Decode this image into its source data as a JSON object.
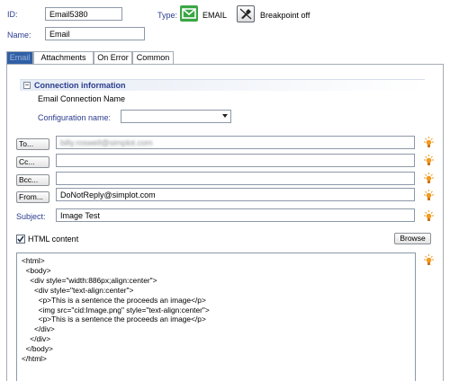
{
  "header": {
    "id_label": "ID:",
    "id_value": "Email5380",
    "name_label": "Name:",
    "name_value": "Email",
    "type_label": "Type:",
    "type_value": "EMAIL",
    "breakpoint_label": "Breakpoint off"
  },
  "tabs": [
    {
      "label": "Email",
      "active": true
    },
    {
      "label": "Attachments",
      "active": false
    },
    {
      "label": "On Error",
      "active": false
    },
    {
      "label": "Common",
      "active": false
    }
  ],
  "connection": {
    "section_title": "Connection information",
    "collapse_glyph": "−",
    "subtitle": "Email Connection Name",
    "config_label": "Configuration name:",
    "config_value": ""
  },
  "recipients": {
    "to_label": "To...",
    "to_value": "billy.roswell@simplot.com",
    "cc_label": "Cc...",
    "cc_value": "",
    "bcc_label": "Bcc...",
    "bcc_value": "",
    "from_label": "From...",
    "from_value": "DoNotReply@simplot.com",
    "subject_label": "Subject:",
    "subject_value": "Image Test"
  },
  "content": {
    "html_checkbox_label": "HTML content",
    "html_checked": true,
    "browse_label": "Browse",
    "body_lines": [
      "<html>",
      "  <body>",
      "    <div style=\"width:886px;align:center\">",
      "      <div style=\"text-align:center\">",
      "        <p>This is a sentence the proceeds an image</p>",
      "        <img src=\"cid:Image.png\" style=\"text-align:center\">",
      "        <p>This is a sentence the proceeds an image</p>",
      "      </div>",
      "    </div>",
      "  </body>",
      "</html>"
    ]
  },
  "colors": {
    "accent_blue": "#2f5fa6",
    "label_blue": "#2b3c8e",
    "email_green": "#3aa644",
    "bulb_orange": "#f39a1f"
  },
  "icons": {
    "type": "email-envelope-icon",
    "breakpoint": "breakpoint-off-icon",
    "dropdown": "chevron-down-icon",
    "assist": "lightbulb-icon"
  }
}
